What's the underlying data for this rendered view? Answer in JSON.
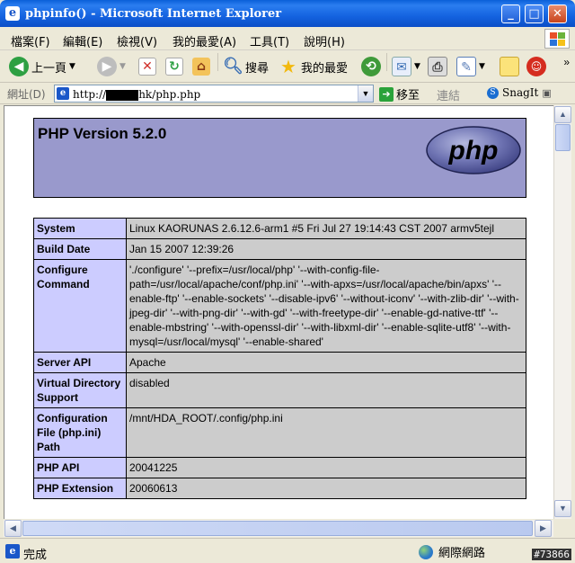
{
  "window": {
    "title": "phpinfo() - Microsoft Internet Explorer",
    "min": "_",
    "max": "□",
    "close": "✕"
  },
  "menu": [
    "檔案(F)",
    "編輯(E)",
    "檢視(V)",
    "我的最愛(A)",
    "工具(T)",
    "說明(H)"
  ],
  "toolbar": {
    "back": "上一頁",
    "search": "搜尋",
    "favorites": "我的最愛",
    "more": "»"
  },
  "address": {
    "label": "網址(D)",
    "url_prefix": "http://",
    "url_suffix": "hk/php.php",
    "go": "移至",
    "links": "連結",
    "snagit": "SnagIt"
  },
  "page": {
    "version_heading": "PHP Version 5.2.0",
    "logo_text": "php",
    "rows": [
      {
        "key": "System",
        "value": "Linux KAORUNAS 2.6.12.6-arm1 #5 Fri Jul 27 19:14:43 CST 2007 armv5tejl"
      },
      {
        "key": "Build Date",
        "value": "Jan 15 2007 12:39:26"
      },
      {
        "key": "Configure Command",
        "value": "'./configure' '--prefix=/usr/local/php' '--with-config-file-path=/usr/local/apache/conf/php.ini' '--with-apxs=/usr/local/apache/bin/apxs' '--enable-ftp' '--enable-sockets' '--disable-ipv6' '--without-iconv' '--with-zlib-dir' '--with-jpeg-dir' '--with-png-dir' '--with-gd' '--with-freetype-dir' '--enable-gd-native-ttf' '--enable-mbstring' '--with-openssl-dir' '--with-libxml-dir' '--enable-sqlite-utf8' '--with-mysql=/usr/local/mysql' '--enable-shared'"
      },
      {
        "key": "Server API",
        "value": "Apache"
      },
      {
        "key": "Virtual Directory Support",
        "value": "disabled"
      },
      {
        "key": "Configuration File (php.ini) Path",
        "value": "/mnt/HDA_ROOT/.config/php.ini"
      },
      {
        "key": "PHP API",
        "value": "20041225"
      },
      {
        "key": "PHP Extension",
        "value": "20060613"
      }
    ]
  },
  "status": {
    "text": "完成",
    "zone": "網際網路",
    "watermark": "#73866"
  },
  "colors": {
    "phpHeader": "#9999cc",
    "keyCell": "#ccccff",
    "valueCell": "#cccccc"
  }
}
